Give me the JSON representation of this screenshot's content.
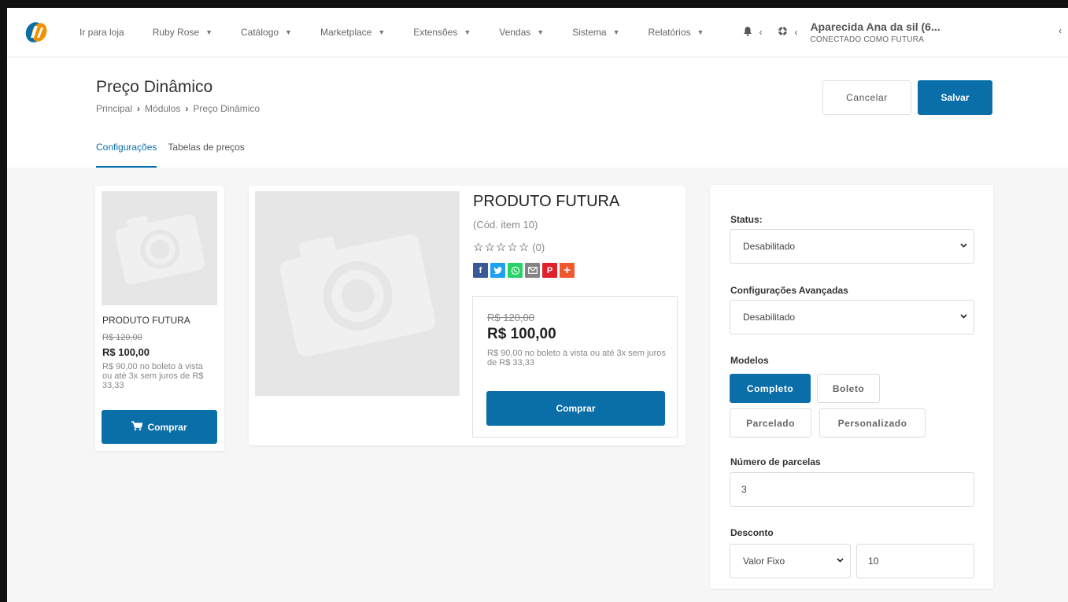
{
  "colors": {
    "primary": "#0a6ea8",
    "page_bg": "#f6f6f6"
  },
  "nav": {
    "logo_icon": "store-logo",
    "items": [
      {
        "label": "Ir para loja",
        "dropdown": false
      },
      {
        "label": "Ruby Rose",
        "dropdown": true
      },
      {
        "label": "Catálogo",
        "dropdown": true
      },
      {
        "label": "Marketplace",
        "dropdown": true
      },
      {
        "label": "Extensões",
        "dropdown": true
      },
      {
        "label": "Vendas",
        "dropdown": true
      },
      {
        "label": "Sistema",
        "dropdown": true
      },
      {
        "label": "Relatórios",
        "dropdown": true
      }
    ],
    "bell_icon": "bell-icon",
    "help_icon": "lifebuoy-icon",
    "user_name": "Aparecida Ana da sil (6...",
    "user_sub": "CONECTADO COMO FUTURA"
  },
  "header": {
    "title": "Preço Dinâmico",
    "breadcrumb": [
      "Principal",
      "Módulos",
      "Preço Dinâmico"
    ],
    "cancel_label": "Cancelar",
    "save_label": "Salvar",
    "tabs": [
      {
        "label": "Configurações",
        "active": true
      },
      {
        "label": "Tabelas de preços",
        "active": false
      }
    ]
  },
  "preview_small": {
    "title": "PRODUTO FUTURA",
    "old_price": "R$ 120,00",
    "price": "R$ 100,00",
    "description": "R$ 90,00 no boleto à vista ou até 3x sem juros de R$ 33,33",
    "buy_label": "Comprar"
  },
  "preview_big": {
    "title": "PRODUTO FUTURA",
    "code": "(Cód. item 10)",
    "rating_count": "(0)",
    "share_icons": [
      "facebook-icon",
      "twitter-icon",
      "whatsapp-icon",
      "email-icon",
      "pinterest-icon",
      "more-share-icon"
    ],
    "old_price": "R$ 120,00",
    "price": "R$ 100,00",
    "description": "R$ 90,00 no boleto à vista ou até 3x sem juros de R$ 33,33",
    "buy_label": "Comprar"
  },
  "settings": {
    "status_label": "Status:",
    "status_value": "Desabilitado",
    "advanced_label": "Configurações Avançadas",
    "advanced_value": "Desabilitado",
    "models_label": "Modelos",
    "models": [
      {
        "label": "Completo",
        "active": true
      },
      {
        "label": "Boleto",
        "active": false
      },
      {
        "label": "Parcelado",
        "active": false
      },
      {
        "label": "Personalizado",
        "active": false
      }
    ],
    "installments_label": "Número de parcelas",
    "installments_value": "3",
    "discount_label": "Desconto",
    "discount_type": "Valor Fixo",
    "discount_value": "10"
  }
}
